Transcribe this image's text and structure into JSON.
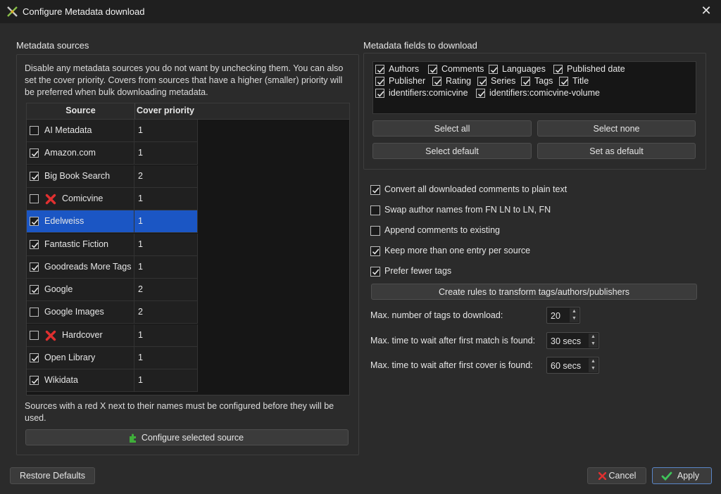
{
  "window": {
    "title": "Configure Metadata download",
    "close_glyph": "✕"
  },
  "sources_group": {
    "label": "Metadata sources",
    "help": "Disable any metadata sources you do not want by unchecking them. You can also set the cover priority. Covers from sources that have a higher (smaller) priority will be preferred when bulk downloading metadata.",
    "columns": [
      "Source",
      "Cover priority"
    ],
    "rows": [
      {
        "name": "AI Metadata",
        "priority": "1",
        "checked": false,
        "needs_config": false,
        "selected": false
      },
      {
        "name": "Amazon.com",
        "priority": "1",
        "checked": true,
        "needs_config": false,
        "selected": false
      },
      {
        "name": "Big Book Search",
        "priority": "2",
        "checked": true,
        "needs_config": false,
        "selected": false
      },
      {
        "name": "Comicvine",
        "priority": "1",
        "checked": false,
        "needs_config": true,
        "selected": false
      },
      {
        "name": "Edelweiss",
        "priority": "1",
        "checked": true,
        "needs_config": false,
        "selected": true
      },
      {
        "name": "Fantastic Fiction",
        "priority": "1",
        "checked": true,
        "needs_config": false,
        "selected": false
      },
      {
        "name": "Goodreads More Tags",
        "priority": "1",
        "checked": true,
        "needs_config": false,
        "selected": false
      },
      {
        "name": "Google",
        "priority": "2",
        "checked": true,
        "needs_config": false,
        "selected": false
      },
      {
        "name": "Google Images",
        "priority": "2",
        "checked": false,
        "needs_config": false,
        "selected": false
      },
      {
        "name": "Hardcover",
        "priority": "1",
        "checked": false,
        "needs_config": true,
        "selected": false
      },
      {
        "name": "Open Library",
        "priority": "1",
        "checked": true,
        "needs_config": false,
        "selected": false
      },
      {
        "name": "Wikidata",
        "priority": "1",
        "checked": true,
        "needs_config": false,
        "selected": false
      }
    ],
    "note": "Sources with a red X next to their names must be configured before they will be used.",
    "configure_button": "Configure selected source"
  },
  "fields_group": {
    "label": "Metadata fields to download",
    "fields": [
      {
        "label": "Authors",
        "checked": true
      },
      {
        "label": "Comments",
        "checked": true
      },
      {
        "label": "Languages",
        "checked": true
      },
      {
        "label": "Published date",
        "checked": true
      },
      {
        "label": "Publisher",
        "checked": true
      },
      {
        "label": "Rating",
        "checked": true
      },
      {
        "label": "Series",
        "checked": true
      },
      {
        "label": "Tags",
        "checked": true
      },
      {
        "label": "Title",
        "checked": true
      },
      {
        "label": "identifiers:comicvine",
        "checked": true
      },
      {
        "label": "identifiers:comicvine-volume",
        "checked": true
      }
    ],
    "buttons": {
      "select_all": "Select all",
      "select_none": "Select none",
      "select_default": "Select default",
      "set_as_default": "Set as default"
    }
  },
  "options": [
    {
      "label": "Convert all downloaded comments to plain text",
      "checked": true
    },
    {
      "label": "Swap author names from FN LN to LN, FN",
      "checked": false
    },
    {
      "label": "Append comments to existing",
      "checked": false
    },
    {
      "label": "Keep more than one entry per source",
      "checked": true
    },
    {
      "label": "Prefer fewer tags",
      "checked": true
    }
  ],
  "rules_button": "Create rules to transform tags/authors/publishers",
  "spinners": {
    "max_tags": {
      "label": "Max. number of tags to download:",
      "value": "20"
    },
    "max_wait_match": {
      "label": "Max. time to wait after first match is found:",
      "value": "30 secs"
    },
    "max_wait_cover": {
      "label": "Max. time to wait after first cover is found:",
      "value": "60 secs"
    }
  },
  "footer": {
    "restore_defaults": "Restore Defaults",
    "cancel": "Cancel",
    "apply": "Apply"
  },
  "colors": {
    "selection": "#1b56c4",
    "error_x": "#e03030",
    "ok_check": "#3fc45a",
    "background": "#2b2b2b"
  },
  "icons": {
    "app": "calibre-icon",
    "config": "puzzle-icon",
    "cancel": "red-x-icon",
    "apply": "green-check-icon"
  }
}
